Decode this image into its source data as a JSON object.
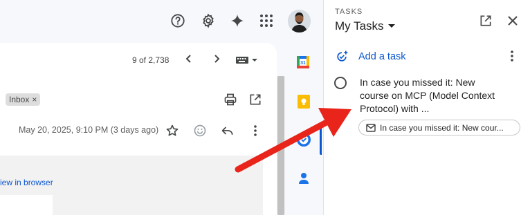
{
  "mail": {
    "pagination": "9 of 2,738",
    "label_chip": "Inbox",
    "label_chip_remove": "×",
    "date": "May 20, 2025, 9:10 PM (3 days ago)",
    "link_text": "iew in browser"
  },
  "tasks": {
    "eyebrow": "TASKS",
    "list_name": "My Tasks",
    "add_task_label": "Add a task",
    "items": [
      {
        "title": "In case you missed it: New course on MCP (Model Context Protocol) with ...",
        "source_chip": "In case you missed it: New cour..."
      }
    ]
  },
  "colors": {
    "accent": "#0b57d0",
    "arrow": "#e8241b",
    "background": "#f6f8fc"
  },
  "icons": [
    "help-icon",
    "settings-icon",
    "gemini-sparkle-icon",
    "apps-grid-icon",
    "avatar",
    "prev-icon",
    "next-icon",
    "keyboard-icon",
    "print-icon",
    "open-in-new-icon",
    "star-icon",
    "emoji-icon",
    "reply-icon",
    "more-vert-icon",
    "calendar-icon",
    "keep-icon",
    "tasks-icon",
    "contacts-icon",
    "close-icon",
    "add-task-icon",
    "checkbox-circle-icon",
    "mail-icon"
  ]
}
